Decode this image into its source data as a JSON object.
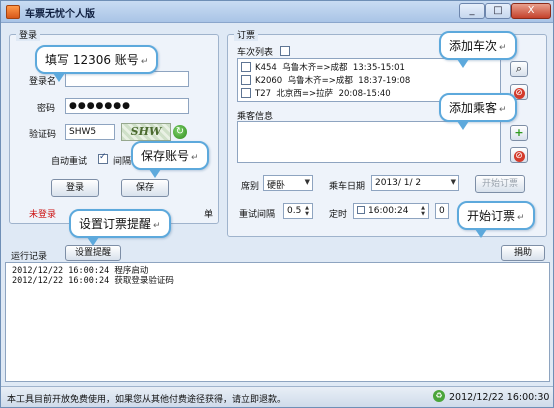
{
  "window": {
    "title": "车票无忧个人版",
    "minimize": "_",
    "maximize": "□",
    "close": "X"
  },
  "login": {
    "legend": "登录",
    "username_label": "登录名",
    "password_label": "密码",
    "password_value": "●●●●●●●",
    "captcha_label": "验证码",
    "captcha_value": "SHW5",
    "captcha_image_text": "SHW",
    "auto_retry_label": "自动重试",
    "interval_label": "间隔",
    "login_button": "登录",
    "save_button": "保存",
    "status": "未登录",
    "order_suffix": "单"
  },
  "order": {
    "legend": "订票",
    "train_list_label": "车次列表",
    "trains": [
      {
        "code": "K454",
        "route": "乌鲁木齐=>成都",
        "time": "13:35-15:01"
      },
      {
        "code": "K2060",
        "route": "乌鲁木齐=>成都",
        "time": "18:37-19:08"
      },
      {
        "code": "T27",
        "route": "北京西=>拉萨",
        "time": "20:08-15:40"
      }
    ],
    "passenger_label": "乘客信息",
    "seat_label": "席别",
    "seat_value": "硬卧",
    "date_label": "乘车日期",
    "date_value": "2013/ 1/ 2",
    "start_button": "开始订票",
    "retry_label": "重试间隔",
    "retry_value": "0.5",
    "timer_label": "定时",
    "timer_value": "16:00:24",
    "extra_value": "0"
  },
  "log": {
    "section_label": "运行记录",
    "reminder_button": "设置提醒",
    "donate_button": "捐助",
    "lines": [
      "2012/12/22 16:00:24 程序启动",
      "2012/12/22 16:00:24 获取登录验证码"
    ]
  },
  "status": {
    "notice": "本工具目前开放免费使用，如果您从其他付费途径获得，请立即退款。",
    "datetime": "2012/12/22 16:00:30"
  },
  "tooltips": {
    "fill_account": "填写 12306 账号",
    "save_account": "保存账号",
    "set_reminder": "设置订票提醒",
    "add_train": "添加车次",
    "add_passenger": "添加乘客",
    "start_order": "开始订票",
    "mark": "↵"
  },
  "colors": {
    "status_red": "#cc1111",
    "tooltip_border": "#5da9dc"
  }
}
